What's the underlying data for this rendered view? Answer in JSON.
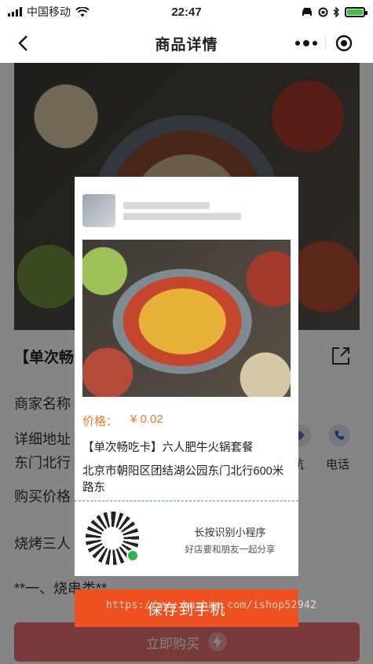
{
  "status_bar": {
    "carrier": "中国移动",
    "time": "22:47"
  },
  "nav": {
    "title": "商品详情"
  },
  "page": {
    "product_title": "【单次畅",
    "merchant_label": "商家名称",
    "address_label": "详细地址",
    "address_line2": "东门北行",
    "price_label": "购买价格",
    "menu_item": "烧烤三人",
    "section_header": "**一、烧串类**",
    "nav_action": "航",
    "phone_action": "电话",
    "buy_button": "立即购买"
  },
  "share_card": {
    "price_label": "价格：",
    "price_value": "¥ 0.02",
    "product_name": "【单次畅吃卡】六人肥牛火锅套餐",
    "address": "北京市朝阳区团结湖公园东门北行600米路东",
    "qr_title": "长按识别小程序",
    "qr_subtitle": "好店要和朋友一起分享"
  },
  "save_button": "保存到手机",
  "watermark": "https://www.huzhan.com/ishop52942"
}
